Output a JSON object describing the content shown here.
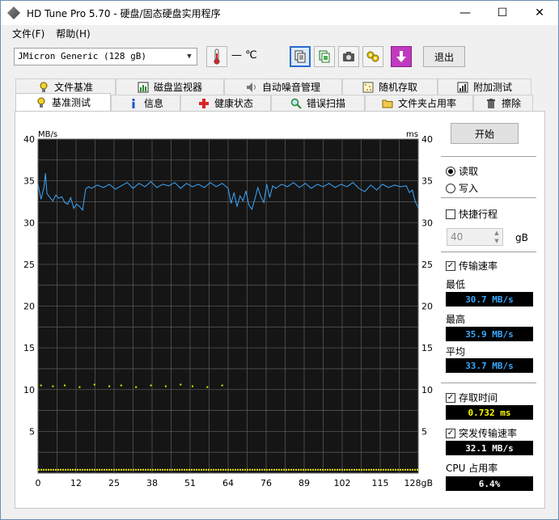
{
  "window": {
    "title": "HD Tune Pro 5.70 - 硬盘/固态硬盘实用程序",
    "controls": {
      "minimize": "—",
      "maximize": "☐",
      "close": "✕"
    }
  },
  "menu": {
    "items": [
      "文件(F)",
      "帮助(H)"
    ]
  },
  "toolbar": {
    "drive": "JMicron Generic (128 gB)",
    "temperature": "— ℃",
    "exit_label": "退出",
    "icons": [
      "thermometer-icon",
      "copy-info-icon",
      "copy-text-icon",
      "camera-icon",
      "options-icon",
      "download-icon"
    ]
  },
  "tabs": {
    "row1": [
      {
        "label": "文件基准",
        "icon": "file-bench-icon"
      },
      {
        "label": "磁盘监视器",
        "icon": "disk-monitor-icon"
      },
      {
        "label": "自动噪音管理",
        "icon": "speaker-icon"
      },
      {
        "label": "随机存取",
        "icon": "random-access-icon"
      },
      {
        "label": "附加测试",
        "icon": "extra-tests-icon"
      }
    ],
    "row2": [
      {
        "label": "基准测试",
        "icon": "bulb-icon",
        "selected": true
      },
      {
        "label": "信息",
        "icon": "info-icon"
      },
      {
        "label": "健康状态",
        "icon": "health-cross-icon"
      },
      {
        "label": "错误扫描",
        "icon": "magnifier-icon"
      },
      {
        "label": "文件夹占用率",
        "icon": "folder-icon"
      },
      {
        "label": "擦除",
        "icon": "trash-icon"
      }
    ]
  },
  "side": {
    "start_label": "开始",
    "read_label": "读取",
    "write_label": "写入",
    "quick_label": "快捷行程",
    "quick_value": "40",
    "gb_label": "gB",
    "transfer_label": "传输速率",
    "min_label": "最低",
    "min_value": "30.7 MB/s",
    "max_label": "最高",
    "max_value": "35.9 MB/s",
    "avg_label": "平均",
    "avg_value": "33.7 MB/s",
    "access_label": "存取时间",
    "access_value": "0.732 ms",
    "burst_label": "突发传输速率",
    "burst_value": "32.1 MB/s",
    "cpu_label": "CPU 占用率",
    "cpu_value": "6.4%",
    "colors": {
      "transfer": "#3aa8ff",
      "access": "#ffff00",
      "cpu": "#ffffff"
    }
  },
  "chart_data": {
    "type": "line",
    "y_left_unit": "MB/s",
    "y_right_unit": "ms",
    "y_ticks": [
      40,
      35,
      30,
      25,
      20,
      15,
      10,
      5
    ],
    "ylim": [
      0,
      40
    ],
    "x_ticks": [
      "0",
      "12",
      "25",
      "38",
      "51",
      "64",
      "76",
      "89",
      "102",
      "115",
      "128gB"
    ],
    "xlim": [
      0,
      128
    ],
    "grid": true,
    "series": [
      {
        "name": "传输速率",
        "color": "#3aa8ff",
        "x": [
          0,
          1,
          2,
          2.5,
          3,
          4,
          5,
          6,
          7,
          8,
          9,
          10,
          11,
          12,
          13,
          14,
          15,
          16,
          17,
          18,
          20,
          22,
          24,
          26,
          28,
          30,
          32,
          34,
          36,
          38,
          40,
          42,
          44,
          46,
          48,
          50,
          52,
          54,
          56,
          58,
          60,
          62,
          64,
          65,
          66,
          67,
          68,
          69,
          70,
          71,
          72,
          73,
          74,
          75,
          76,
          77,
          78,
          79,
          80,
          82,
          84,
          86,
          88,
          90,
          92,
          94,
          96,
          98,
          100,
          102,
          104,
          106,
          108,
          110,
          112,
          114,
          116,
          118,
          120,
          122,
          124,
          125,
          126,
          127,
          128
        ],
        "values": [
          34.6,
          32.8,
          34.2,
          35.9,
          33.5,
          33.0,
          32.6,
          33.3,
          32.9,
          33.1,
          32.4,
          32.2,
          33.0,
          31.7,
          32.2,
          31.9,
          31.5,
          34.0,
          34.3,
          34.1,
          34.5,
          34.2,
          34.6,
          34.0,
          34.4,
          34.8,
          34.1,
          34.7,
          34.3,
          34.9,
          34.2,
          34.6,
          34.4,
          34.8,
          34.1,
          34.7,
          34.3,
          34.6,
          34.2,
          34.8,
          34.3,
          34.7,
          34.1,
          32.3,
          33.6,
          31.9,
          33.2,
          32.6,
          33.8,
          32.1,
          31.6,
          32.8,
          34.2,
          33.1,
          32.4,
          34.6,
          33.0,
          34.4,
          34.1,
          34.6,
          34.3,
          34.8,
          34.2,
          34.7,
          34.1,
          34.6,
          34.3,
          34.7,
          34.2,
          34.6,
          34.3,
          34.8,
          34.1,
          33.7,
          34.5,
          33.9,
          34.6,
          34.2,
          34.5,
          34.3,
          34.4,
          33.6,
          33.9,
          32.5,
          31.8
        ]
      }
    ],
    "access_points_ms": {
      "x": [
        1,
        5,
        9,
        14,
        19,
        24,
        28,
        33,
        38,
        43,
        48,
        52,
        57,
        62
      ],
      "values": [
        10.5,
        10.4,
        10.5,
        10.3,
        10.6,
        10.4,
        10.5,
        10.3,
        10.5,
        10.4,
        10.6,
        10.4,
        10.3,
        10.5
      ]
    },
    "access_baseline_ms": 0.4
  }
}
